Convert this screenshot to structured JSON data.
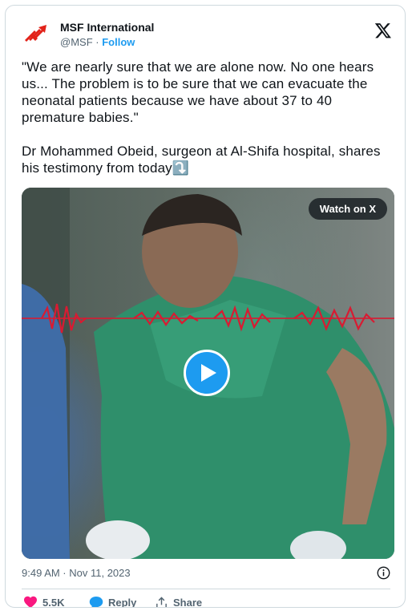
{
  "author": {
    "name": "MSF International",
    "handle": "@MSF",
    "separator": "·",
    "follow_label": "Follow"
  },
  "tweet": {
    "text": "\"We are nearly sure that we are alone now. No one hears us... The problem is to be sure that we can evacuate the neonatal patients because we have about 37 to 40 premature babies.\"\n\nDr Mohammed Obeid, surgeon at Al-Shifa hospital, shares his testimony from today⤵️",
    "timestamp": "9:49 AM · Nov 11, 2023"
  },
  "media": {
    "watch_label": "Watch on X"
  },
  "actions": {
    "likes": "5.5K",
    "reply_label": "Reply",
    "share_label": "Share"
  },
  "colors": {
    "accent": "#1d9bf0",
    "like": "#f91880",
    "brand_red": "#e2231a",
    "waveform": "#d81b32"
  },
  "icons": {
    "logo": "msf-logo-icon",
    "x": "x-logo-icon",
    "play": "play-icon",
    "info": "info-icon",
    "like": "heart-icon",
    "reply": "reply-bubble-icon",
    "share": "share-icon"
  }
}
